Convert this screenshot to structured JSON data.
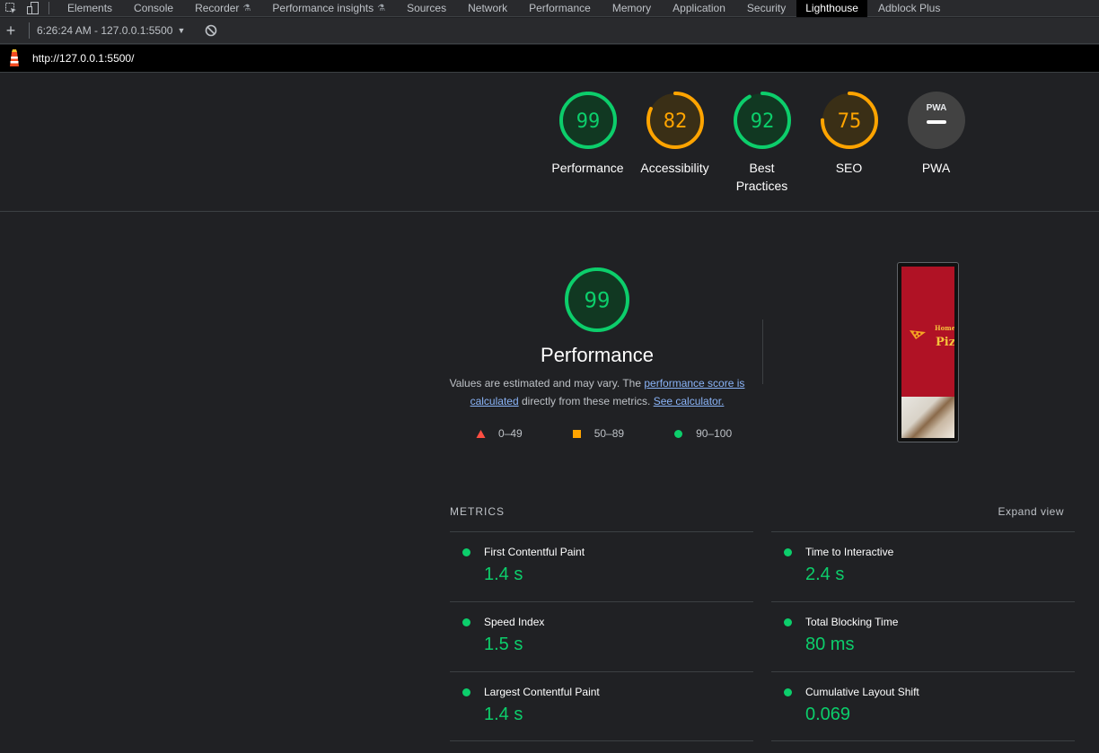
{
  "tabs": {
    "items": [
      {
        "label": "Elements"
      },
      {
        "label": "Console"
      },
      {
        "label": "Recorder",
        "flask": true
      },
      {
        "label": "Performance insights",
        "flask": true
      },
      {
        "label": "Sources"
      },
      {
        "label": "Network"
      },
      {
        "label": "Performance"
      },
      {
        "label": "Memory"
      },
      {
        "label": "Application"
      },
      {
        "label": "Security"
      },
      {
        "label": "Lighthouse",
        "active": true
      },
      {
        "label": "Adblock Plus"
      }
    ]
  },
  "report_bar": {
    "selected_report": "6:26:24 AM - 127.0.0.1:5500"
  },
  "url_bar": {
    "url": "http://127.0.0.1:5500/"
  },
  "summary_gauges": [
    {
      "score": "99",
      "score_value": 99,
      "label": "Performance",
      "status": "pass"
    },
    {
      "score": "82",
      "score_value": 82,
      "label": "Accessibility",
      "status": "average"
    },
    {
      "score": "92",
      "score_value": 92,
      "label": "Best Practices",
      "status": "pass"
    },
    {
      "score": "75",
      "score_value": 75,
      "label": "SEO",
      "status": "average"
    },
    {
      "label": "PWA",
      "badge_text": "PWA",
      "status": "na"
    }
  ],
  "performance": {
    "score": "99",
    "score_value": 99,
    "title": "Performance",
    "desc_prefix": "Values are estimated and may vary. The ",
    "link_score": "performance score is calculated",
    "desc_middle": " directly from these metrics. ",
    "link_calc": "See calculator."
  },
  "legend": [
    {
      "range": "0–49",
      "shape": "triangle",
      "color": "#ff4e42"
    },
    {
      "range": "50–89",
      "shape": "square",
      "color": "#ffa400"
    },
    {
      "range": "90–100",
      "shape": "circle",
      "color": "#0cce6b"
    }
  ],
  "screenshot": {
    "brand_small": "Home",
    "brand_big": "Piz"
  },
  "metrics": {
    "heading": "METRICS",
    "expand_label": "Expand view",
    "items": [
      {
        "name": "First Contentful Paint",
        "value": "1.4 s"
      },
      {
        "name": "Time to Interactive",
        "value": "2.4 s"
      },
      {
        "name": "Speed Index",
        "value": "1.5 s"
      },
      {
        "name": "Total Blocking Time",
        "value": "80 ms"
      },
      {
        "name": "Largest Contentful Paint",
        "value": "1.4 s"
      },
      {
        "name": "Cumulative Layout Shift",
        "value": "0.069"
      }
    ]
  },
  "colors": {
    "pass": "#0cce6b",
    "average": "#ffa400",
    "fail": "#ff4e42",
    "pass_bg": "#113822",
    "average_bg": "#3a2f16",
    "na_bg": "#424242"
  }
}
